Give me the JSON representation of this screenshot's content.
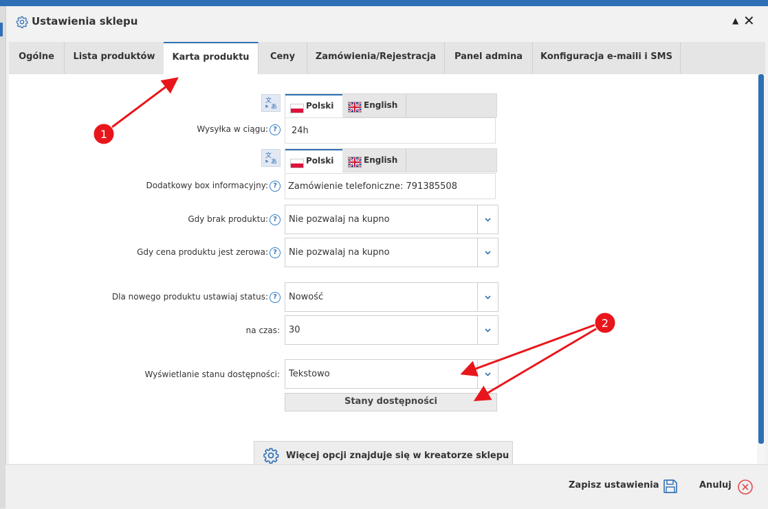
{
  "dialog": {
    "title": "Ustawienia sklepu",
    "collapse_glyph": "▲",
    "close_glyph": "✕"
  },
  "tabs": [
    {
      "label": "Ogólne"
    },
    {
      "label": "Lista produktów"
    },
    {
      "label": "Karta produktu",
      "active": true
    },
    {
      "label": "Ceny"
    },
    {
      "label": "Zamówienia/Rejestracja"
    },
    {
      "label": "Panel admina"
    },
    {
      "label": "Konfiguracja e-maili i SMS"
    }
  ],
  "languages": {
    "polish": "Polski",
    "english": "English"
  },
  "form": {
    "shipping": {
      "label": "Wysyłka w ciągu:",
      "value": "24h"
    },
    "infobox": {
      "label": "Dodatkowy box informacyjny:",
      "value": "Zamówienie telefoniczne: 791385508"
    },
    "no_product": {
      "label": "Gdy brak produktu:",
      "value": "Nie pozwalaj na kupno"
    },
    "zero_price": {
      "label": "Gdy cena produktu jest zerowa:",
      "value": "Nie pozwalaj na kupno"
    },
    "new_status": {
      "label": "Dla nowego produktu ustawiaj status:",
      "value": "Nowość"
    },
    "duration": {
      "label": "na czas:",
      "value": "30"
    },
    "availability_display": {
      "label": "Wyświetlanie stanu dostępności:",
      "value": "Tekstowo"
    },
    "availability_states_button": "Stany dostępności",
    "help_glyph": "?"
  },
  "wizard_button": "Więcej opcji znajduje się w kreatorze sklepu",
  "footer": {
    "save": "Zapisz ustawienia",
    "cancel": "Anuluj"
  },
  "annotations": {
    "marker_1": "1",
    "marker_2": "2"
  },
  "colors": {
    "accent": "#2f6fb5",
    "annotation": "#e8161b",
    "cancel": "#e5484d"
  }
}
